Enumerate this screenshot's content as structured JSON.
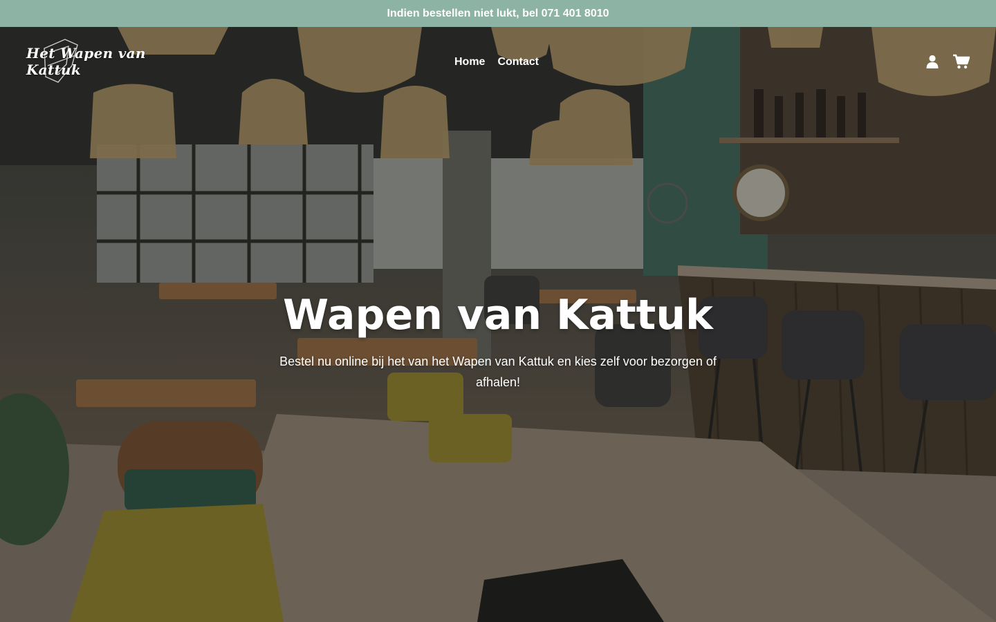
{
  "announcement": {
    "text": "Indien bestellen niet lukt, bel 071 401 8010"
  },
  "header": {
    "logo_text": "Het Wapen van Kattuk",
    "nav": [
      {
        "label": "Home"
      },
      {
        "label": "Contact"
      }
    ],
    "icons": [
      "user-icon",
      "cart-icon"
    ]
  },
  "hero": {
    "title": "Wapen van Kattuk",
    "subtitle": "Bestel nu online bij het van het Wapen van Kattuk en kies zelf voor bezorgen of afhalen!"
  },
  "colors": {
    "announcement_bg": "#8db3a5",
    "text": "#ffffff"
  }
}
